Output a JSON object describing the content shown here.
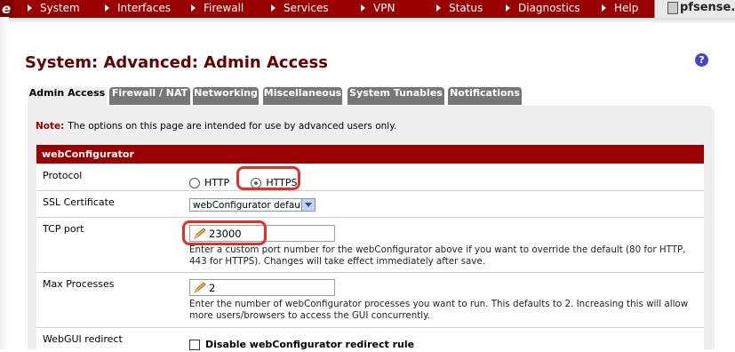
{
  "nav": {
    "logo_char": "e",
    "items": [
      "System",
      "Interfaces",
      "Firewall",
      "Services",
      "VPN",
      "Status",
      "Diagnostics",
      "Help"
    ],
    "brand": "pfsense.s"
  },
  "page": {
    "title": "System: Advanced: Admin Access",
    "help_glyph": "?"
  },
  "tabs": [
    "Admin Access",
    "Firewall / NAT",
    "Networking",
    "Miscellaneous",
    "System Tunables",
    "Notifications"
  ],
  "note": {
    "label": "Note:",
    "text": "The options on this page are intended for use by advanced users only."
  },
  "section": {
    "title": "webConfigurator",
    "protocol": {
      "label": "Protocol",
      "options": [
        "HTTP",
        "HTTPS"
      ],
      "selected": "HTTPS"
    },
    "ssl_certificate": {
      "label": "SSL Certificate",
      "value": "webConfigurator default"
    },
    "tcp_port": {
      "label": "TCP port",
      "value": "23000",
      "help": "Enter a custom port number for the webConfigurator above if you want to override the default (80 for HTTP, 443 for HTTPS). Changes will take effect immediately after save."
    },
    "max_processes": {
      "label": "Max Processes",
      "value": "2",
      "help": "Enter the number of webConfigurator processes you want to run. This defaults to 2. Increasing this will allow more users/browsers to access the GUI concurrently."
    },
    "webgui_redirect": {
      "label": "WebGUI redirect",
      "checkbox_label": "Disable webConfigurator redirect rule",
      "checked": false
    }
  },
  "colors": {
    "nav_bg": "#990000",
    "title": "#660000",
    "section_header": "#990000",
    "highlight": "#e0302a"
  }
}
